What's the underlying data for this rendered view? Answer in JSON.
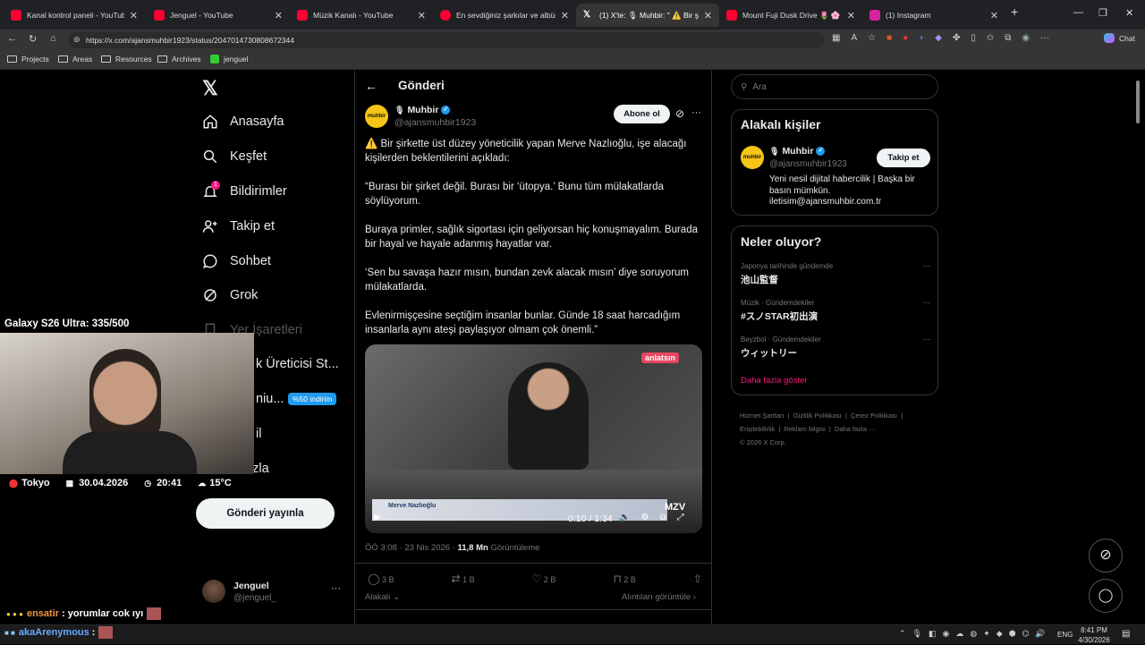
{
  "browser": {
    "tabs": [
      {
        "title": "Kanal kontrol paneli - YouTube St",
        "color": "#ff0033"
      },
      {
        "title": "Jenguel - YouTube",
        "color": "#ff0033"
      },
      {
        "title": "Müzik Kanalı - YouTube",
        "color": "#ff0033"
      },
      {
        "title": "En sevdiğiniz şarkılar ve albümleri",
        "color": "#ff0033"
      },
      {
        "title": "(1) X'te: 🎙 Muhbir: \" ⚠️ Bir şirkette",
        "color": "#ffffff"
      },
      {
        "title": "Mount Fuji Dusk Drive 🌷 🌸 / 8K",
        "color": "#ff0033"
      },
      {
        "title": "(1) Instagram",
        "color": "#d6249f"
      }
    ],
    "url": "https://x.com/ajansmuhbir1923/status/2047014730808672344",
    "chat_label": "Chat",
    "bookmarks": [
      "Projects",
      "Areas",
      "Resources",
      "Archives",
      "jenguel"
    ]
  },
  "sidebar": {
    "items": [
      {
        "label": "Anasayfa"
      },
      {
        "label": "Keşfet"
      },
      {
        "label": "Bildirimler",
        "badge": "1"
      },
      {
        "label": "Takip et"
      },
      {
        "label": "Sohbet"
      },
      {
        "label": "Grok"
      },
      {
        "label": "Yer İşaretleri"
      },
      {
        "label": "k Üreticisi St..."
      },
      {
        "label": "niu...",
        "badge": "%50 indirim"
      },
      {
        "label": "il"
      },
      {
        "label": "a fazla"
      }
    ],
    "post_button": "Gönderi yayınla",
    "account": {
      "name": "Jenguel",
      "handle": "@jenguel_"
    }
  },
  "post": {
    "header_title": "Gönderi",
    "author_name": "Muhbir",
    "author_handle": "@ajansmuhbir1923",
    "avatar_text": "muhbir",
    "subscribe_label": "Abone ol",
    "paragraphs": [
      "⚠️ Bir şirkette üst düzey yöneticilik yapan Merve Nazlıoğlu, işe alacağı kişilerden beklentilerini açıkladı:",
      "“Burası bir şirket değil. Burası bir ‘ütopya.’ Bunu tüm mülakatlarda söylüyorum.",
      "Buraya primler, sağlık sigortası için geliyorsan hiç konuşmayalım. Burada bir hayal ve hayale adanmış hayatlar var.",
      "‘Sen bu savaşa hazır mısın, bundan zevk alacak mısın’ diye soruyorum mülakatlarda.",
      "Evlenirmişçesine seçtiğim insanlar bunlar. Günde 18 saat harcadığım insanlarla aynı ateşi paylaşıyor olmam çok önemli.”"
    ],
    "video": {
      "brand": "anlatsın",
      "lower_third_name": "Merve Nazlıoğlu",
      "channel_logo": "MZV",
      "time": "0:10 / 1:34"
    },
    "meta_time": "ÖÖ 3:08 · 23 Nis 2026 ·",
    "views": "11,8 Mn",
    "views_label": "Görüntüleme",
    "actions": {
      "replies": "3 B",
      "reposts": "1 B",
      "likes": "2 B",
      "bookmarks": "2 B"
    },
    "related_label": "Alakalı",
    "quotes_label": "Alıntıları görüntüle"
  },
  "right": {
    "search_placeholder": "Ara",
    "related_title": "Alakalı kişiler",
    "related": {
      "name": "Muhbir",
      "handle": "@ajansmuhbir1923",
      "follow_label": "Takip et",
      "bio": "Yeni nesil dijital habercilik | Başka bir basın mümkün.",
      "email": "iletisim@ajansmuhbir.com.tr"
    },
    "trends_title": "Neler oluyor?",
    "trends": [
      {
        "context": "Japonya tarihinde gündemde",
        "name": "池山監督"
      },
      {
        "context": "Müzik · Gündemdekiler",
        "name": "#スノSTAR初出演"
      },
      {
        "context": "Beyzbol · Gündemdekiler",
        "name": "ウィットリー"
      }
    ],
    "show_more": "Daha fazla göster",
    "footer_links": [
      "Hizmet Şartları",
      "Gizlilik Politikası",
      "Çerez Politikası",
      "Erişilebilirlik",
      "Reklam bilgisi",
      "Daha fazla ···"
    ],
    "copyright": "© 2026 X Corp."
  },
  "overlay": {
    "goal": "Galaxy S26 Ultra: 335/500",
    "location": "Tokyo",
    "date": "30.04.2026",
    "time": "20:41",
    "weather": "15°C",
    "chat": [
      {
        "user": "ensatir",
        "message": ": yorumlar cok ıyı"
      },
      {
        "user": "akaArenymous",
        "message": ":"
      }
    ]
  },
  "taskbar": {
    "lang": "ENG",
    "clock": "8:41 PM",
    "date": "4/30/2026"
  },
  "colors": {
    "accent": "#1d9bf0",
    "link_pink": "#f91880",
    "bg": "#000000",
    "border": "#2f3336"
  }
}
